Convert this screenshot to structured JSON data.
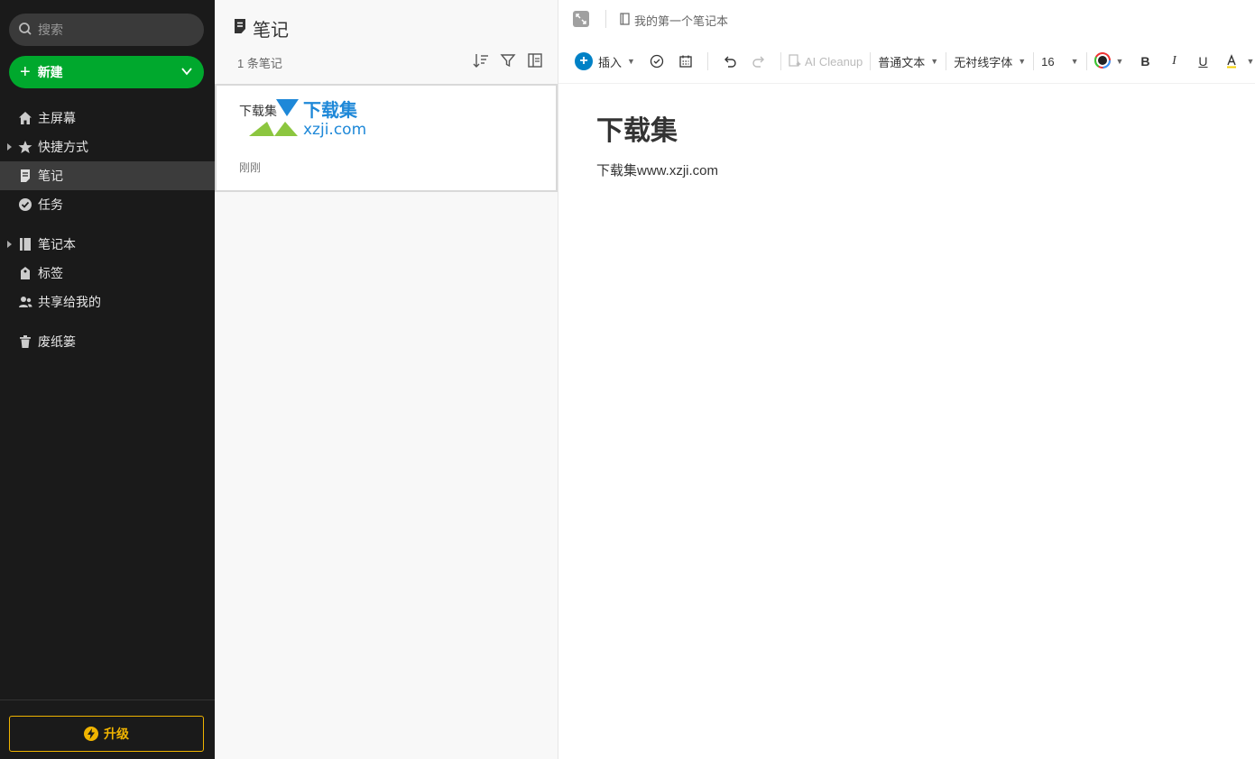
{
  "sidebar": {
    "search_placeholder": "搜索",
    "new_label": "新建",
    "items": [
      {
        "label": "主屏幕",
        "icon": "home-icon"
      },
      {
        "label": "快捷方式",
        "icon": "star-icon"
      },
      {
        "label": "笔记",
        "icon": "note-icon"
      },
      {
        "label": "任务",
        "icon": "check-circle-icon"
      },
      {
        "label": "笔记本",
        "icon": "notebook-icon"
      },
      {
        "label": "标签",
        "icon": "tag-icon"
      },
      {
        "label": "共享给我的",
        "icon": "people-icon"
      },
      {
        "label": "废纸篓",
        "icon": "trash-icon"
      }
    ],
    "upgrade_label": "升级"
  },
  "notelist": {
    "title": "笔记",
    "count": "1 条笔记",
    "notes": [
      {
        "title": "下载集",
        "date": "刚刚"
      }
    ],
    "watermark": {
      "cn": "下载集",
      "url": "xzji.com"
    }
  },
  "editor": {
    "breadcrumb": "我的第一个笔记本",
    "toolbar": {
      "insert": "插入",
      "ai": "AI Cleanup",
      "style": "普通文本",
      "font": "无衬线字体",
      "size": "16"
    },
    "doc_title": "下载集",
    "doc_body": "下载集www.xzji.com"
  },
  "colors": {
    "sidebar_bg": "#1a1a1a",
    "accent_green": "#00a82d",
    "upgrade_gold": "#f0b400",
    "insert_blue": "#0081c6"
  }
}
